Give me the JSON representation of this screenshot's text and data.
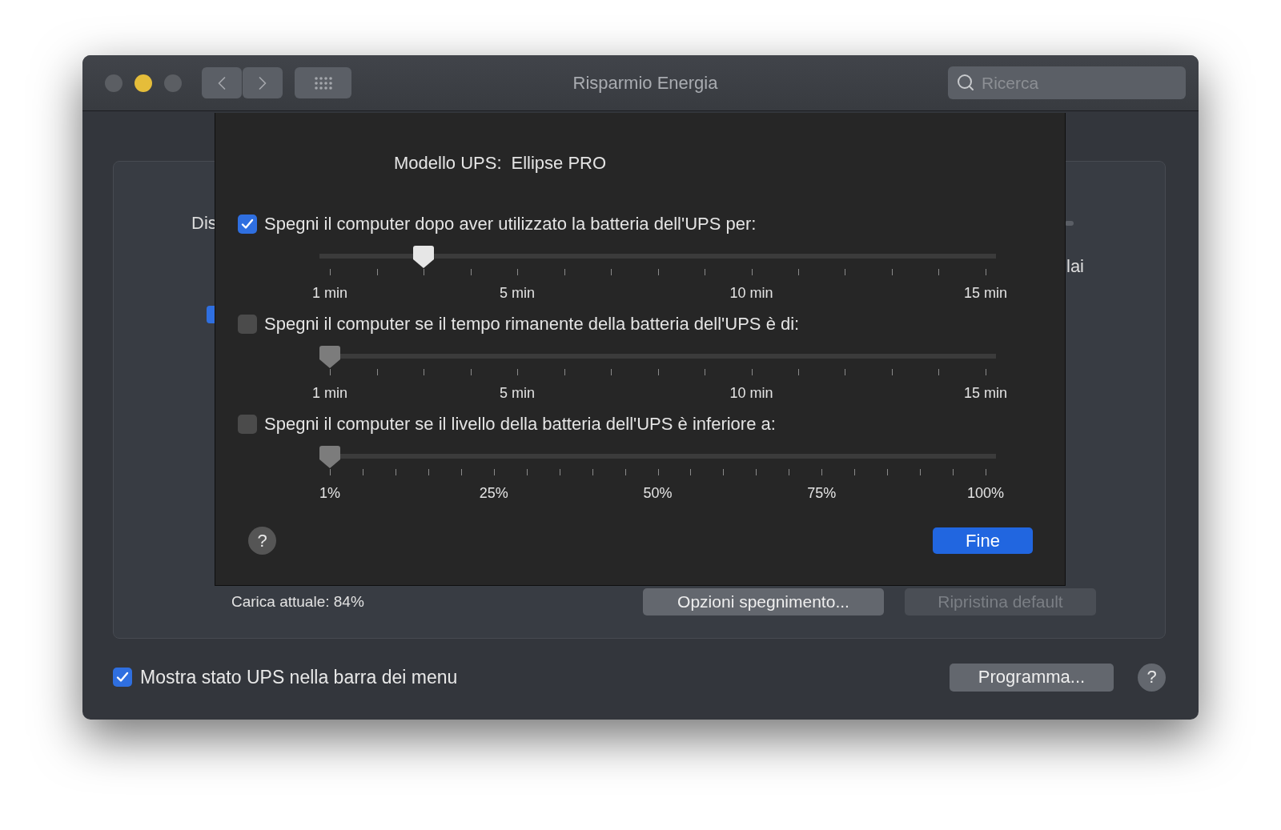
{
  "window": {
    "title": "Risparmio Energia",
    "lights": [
      {
        "color": "#5b5e63"
      },
      {
        "color": "#e5bd3a"
      },
      {
        "color": "#5b5e63"
      }
    ]
  },
  "search": {
    "placeholder": "Ricerca"
  },
  "background": {
    "label_1": "Dis",
    "label_2": "lai",
    "checkbox": {
      "checked": true
    },
    "charge": "Carica attuale: 84%",
    "buttons": [
      {
        "label": "Opzioni spegnimento...",
        "disabled": false
      },
      {
        "label": "Ripristina default",
        "disabled": true
      }
    ],
    "menu_checkbox": {
      "label": "Mostra stato UPS nella barra dei menu",
      "checked": true
    },
    "schedule_button": "Programma...",
    "help": "?"
  },
  "sheet": {
    "model_label": "Modello UPS:",
    "model_value": "Ellipse PRO",
    "options": [
      {
        "label": "Spegni il computer dopo aver utilizzato la batteria dell'UPS per:",
        "checked": true,
        "kind": "minutes",
        "level": 0.143,
        "tick_labels": [
          "1 min",
          "5 min",
          "10 min",
          "15 min"
        ]
      },
      {
        "label": "Spegni il computer se il tempo rimanente della batteria dell'UPS è di:",
        "checked": false,
        "kind": "minutes",
        "level": 0,
        "tick_labels": [
          "1 min",
          "5 min",
          "10 min",
          "15 min"
        ]
      },
      {
        "label": "Spegni il computer se il livello della batteria dell'UPS è inferiore a:",
        "checked": false,
        "kind": "percent",
        "level": 0,
        "tick_labels": [
          "1%",
          "25%",
          "50%",
          "75%",
          "100%"
        ]
      }
    ],
    "help": "?",
    "done_button": "Fine"
  }
}
